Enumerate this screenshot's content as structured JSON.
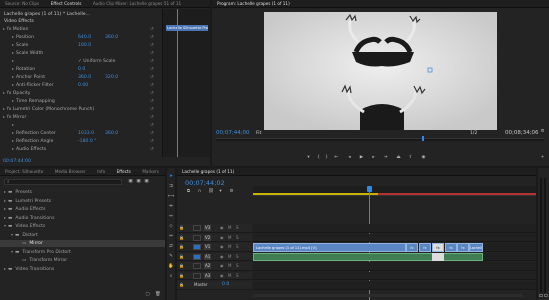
{
  "tabs_top_left": [
    "Source: No Clips",
    "Effect Controls",
    "Audio Clip Mixer: Lachelle grapes 51 of 11"
  ],
  "fx": {
    "clip_header": "Lachelle grapes (1 of 11) * Lachelle...",
    "sub_header": "Lachelle Silhouette Pro",
    "video_effects": "Video Effects",
    "rows": [
      {
        "name": "fx  Motion",
        "val": "",
        "val2": ""
      },
      {
        "name": "Position",
        "val": "640.0",
        "val2": "360.0"
      },
      {
        "name": "Scale",
        "val": "100.0",
        "val2": ""
      },
      {
        "name": "Scale Width",
        "val": "",
        "val2": ""
      },
      {
        "name": "",
        "val": "✓ Uniform Scale",
        "val2": ""
      },
      {
        "name": "Rotation",
        "val": "0.0",
        "val2": ""
      },
      {
        "name": "Anchor Point",
        "val": "360.0",
        "val2": "320.0"
      },
      {
        "name": "Anti-flicker Filter",
        "val": "0.00",
        "val2": ""
      },
      {
        "name": "fx  Opacity",
        "val": "",
        "val2": ""
      },
      {
        "name": "Time Remapping",
        "val": "",
        "val2": ""
      },
      {
        "name": "fx  Lumetri Color (Monochrome Punch)",
        "val": "",
        "val2": ""
      },
      {
        "name": "fx  Mirror",
        "val": "",
        "val2": ""
      },
      {
        "name": "",
        "val": "",
        "val2": ""
      },
      {
        "name": "Reflection Center",
        "val": "1033.0",
        "val2": "360.0"
      },
      {
        "name": "Reflection Angle",
        "val": "-180.0 °",
        "val2": ""
      },
      {
        "name": "Audio Effects",
        "val": "",
        "val2": ""
      }
    ],
    "timecode": "00:07:44:00"
  },
  "program": {
    "tab": "Program: Lachelle grapes (1 of 11)",
    "timecode": "00;07;44;00",
    "fit": "Fit",
    "fraction": "1/2",
    "duration": "00;08;34;06"
  },
  "tabs_bottom_left": [
    "Project: Silhouette",
    "Media Browser",
    "Info",
    "Effects",
    "Markers"
  ],
  "effects": {
    "search": "",
    "items": [
      {
        "label": "Presets",
        "depth": 0,
        "open": false
      },
      {
        "label": "Lumetri Presets",
        "depth": 0,
        "open": false
      },
      {
        "label": "Audio Effects",
        "depth": 0,
        "open": false
      },
      {
        "label": "Audio Transitions",
        "depth": 0,
        "open": false
      },
      {
        "label": "Video Effects",
        "depth": 0,
        "open": true
      },
      {
        "label": "Distort",
        "depth": 1,
        "open": true
      },
      {
        "label": "Mirror",
        "depth": 2,
        "open": false,
        "sel": true
      },
      {
        "label": "Transform Pro Distort",
        "depth": 1,
        "open": true
      },
      {
        "label": "Transform Mirror",
        "depth": 2,
        "open": false
      },
      {
        "label": "Video Transitions",
        "depth": 0,
        "open": false
      }
    ]
  },
  "timeline": {
    "tab": "Lachelle grapes (1 of 11)",
    "timecode": "00;07;44;02",
    "tracks": [
      {
        "name": "V3",
        "clip": ""
      },
      {
        "name": "V2",
        "clip": ""
      },
      {
        "name": "V1",
        "clip": "Lachelle grapes (1 of 11).mp4 [V]"
      },
      {
        "name": "A1",
        "clip": ""
      },
      {
        "name": "A2",
        "clip": ""
      },
      {
        "name": "A3",
        "clip": ""
      },
      {
        "name": "Master",
        "clip": "0.0"
      }
    ],
    "fx_label": "fx",
    "end_label": "Lachelle"
  },
  "colors": {
    "accent": "#2d8ceb",
    "clip": "#5b86c4",
    "audio": "#3f7d52",
    "yellow": "#c8b400"
  }
}
